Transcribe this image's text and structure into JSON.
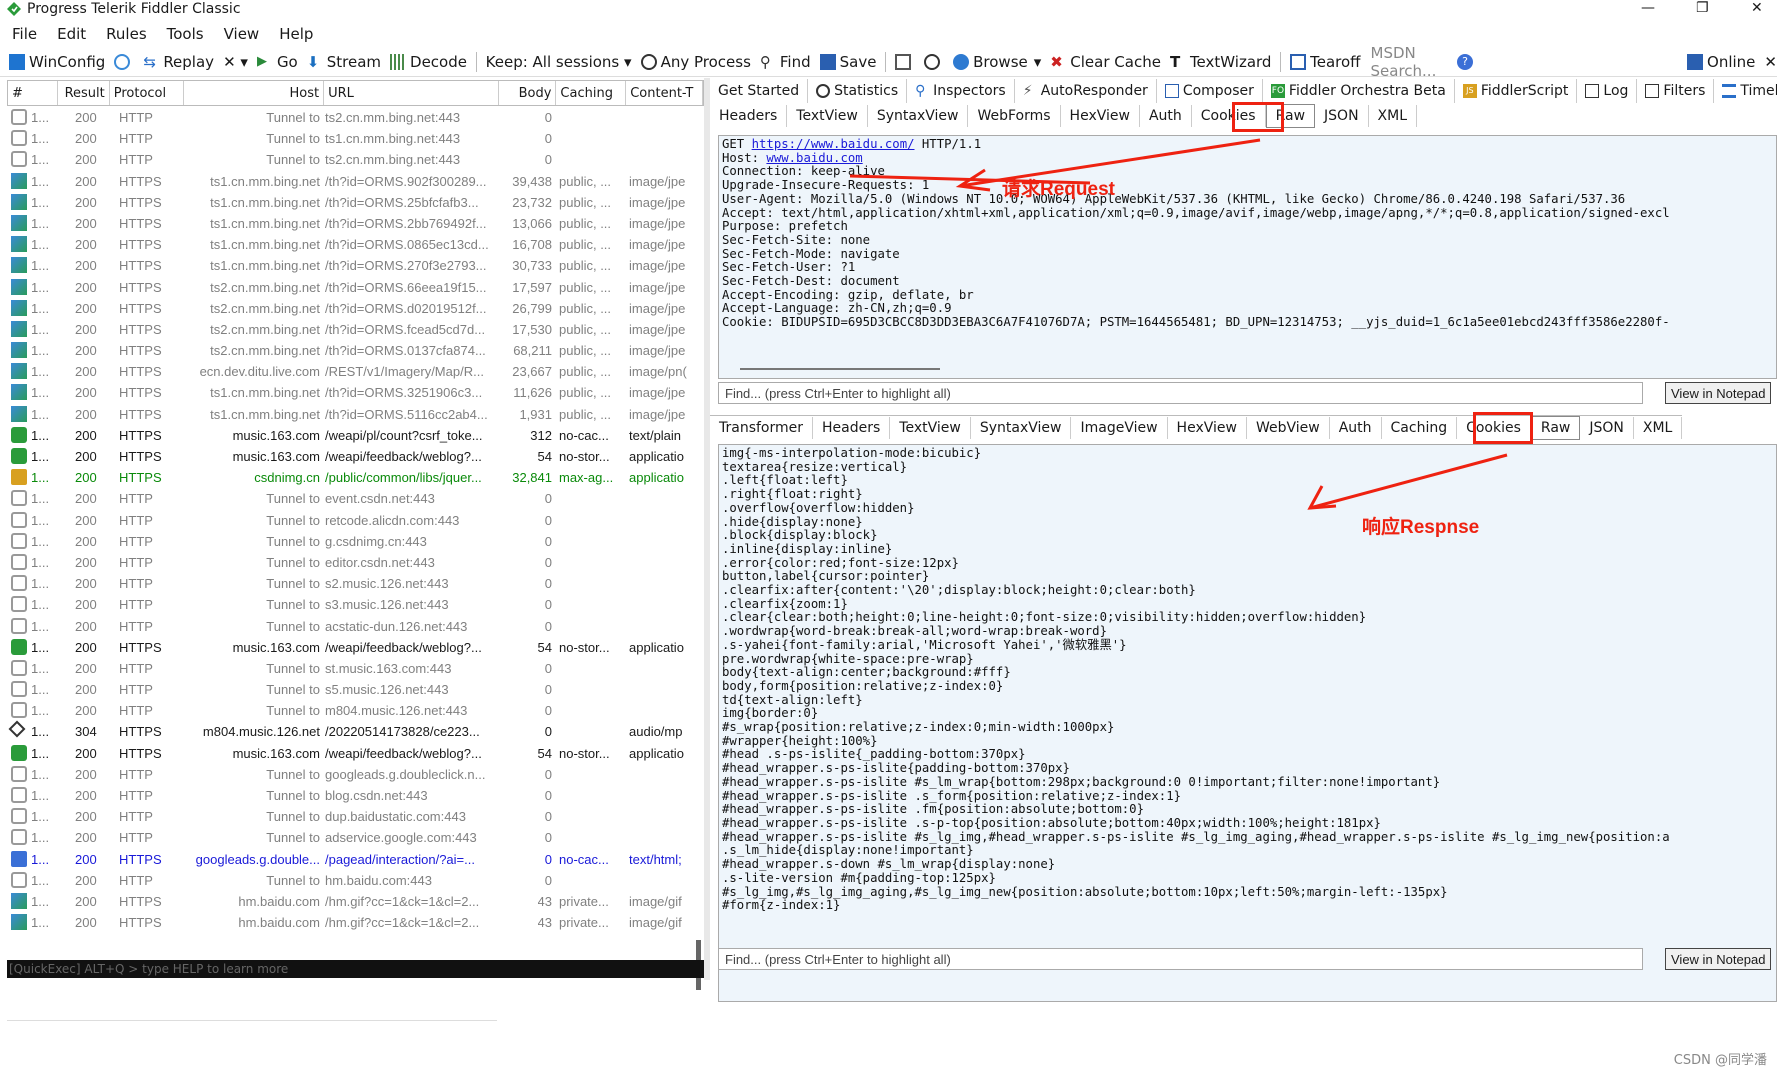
{
  "window": {
    "title": "Progress Telerik Fiddler Classic"
  },
  "window_controls": {
    "minimize": "—",
    "maximize": "❐",
    "close": "✕"
  },
  "menu": [
    "File",
    "Edit",
    "Rules",
    "Tools",
    "View",
    "Help"
  ],
  "toolbar": {
    "winconfig": "WinConfig",
    "replay": "Replay",
    "remove": "✕ ▾",
    "go": "Go",
    "stream": "Stream",
    "decode": "Decode",
    "keep": "Keep: All sessions ▾",
    "process": "Any Process",
    "find": "Find",
    "save": "Save",
    "browse": "Browse",
    "clear_cache": "Clear Cache",
    "textwizard": "TextWizard",
    "tearoff": "Tearoff",
    "msdn": "MSDN Search...",
    "online": "Online",
    "close": "✕"
  },
  "sessions": {
    "headers": [
      "#",
      "Result",
      "Protocol",
      "Host",
      "URL",
      "Body",
      "Caching",
      "Content-T"
    ],
    "rows": [
      {
        "n": "1...",
        "r": "200",
        "p": "HTTP",
        "h": "Tunnel to",
        "u": "ts2.cn.mm.bing.net:443",
        "b": "0",
        "c": "",
        "t": "",
        "s": "tunnel"
      },
      {
        "n": "1...",
        "r": "200",
        "p": "HTTP",
        "h": "Tunnel to",
        "u": "ts1.cn.mm.bing.net:443",
        "b": "0",
        "c": "",
        "t": "",
        "s": "tunnel"
      },
      {
        "n": "1...",
        "r": "200",
        "p": "HTTP",
        "h": "Tunnel to",
        "u": "ts2.cn.mm.bing.net:443",
        "b": "0",
        "c": "",
        "t": "",
        "s": "tunnel"
      },
      {
        "n": "1...",
        "r": "200",
        "p": "HTTPS",
        "h": "ts1.cn.mm.bing.net",
        "u": "/th?id=ORMS.902f300289...",
        "b": "39,438",
        "c": "public, ...",
        "t": "image/jpe",
        "s": "image"
      },
      {
        "n": "1...",
        "r": "200",
        "p": "HTTPS",
        "h": "ts1.cn.mm.bing.net",
        "u": "/th?id=ORMS.25bfcfafb3...",
        "b": "23,732",
        "c": "public, ...",
        "t": "image/jpe",
        "s": "image"
      },
      {
        "n": "1...",
        "r": "200",
        "p": "HTTPS",
        "h": "ts1.cn.mm.bing.net",
        "u": "/th?id=ORMS.2bb769492f...",
        "b": "13,066",
        "c": "public, ...",
        "t": "image/jpe",
        "s": "image"
      },
      {
        "n": "1...",
        "r": "200",
        "p": "HTTPS",
        "h": "ts1.cn.mm.bing.net",
        "u": "/th?id=ORMS.0865ec13cd...",
        "b": "16,708",
        "c": "public, ...",
        "t": "image/jpe",
        "s": "image"
      },
      {
        "n": "1...",
        "r": "200",
        "p": "HTTPS",
        "h": "ts1.cn.mm.bing.net",
        "u": "/th?id=ORMS.270f3e2793...",
        "b": "30,733",
        "c": "public, ...",
        "t": "image/jpe",
        "s": "image"
      },
      {
        "n": "1...",
        "r": "200",
        "p": "HTTPS",
        "h": "ts2.cn.mm.bing.net",
        "u": "/th?id=ORMS.66eea19f15...",
        "b": "17,597",
        "c": "public, ...",
        "t": "image/jpe",
        "s": "image"
      },
      {
        "n": "1...",
        "r": "200",
        "p": "HTTPS",
        "h": "ts2.cn.mm.bing.net",
        "u": "/th?id=ORMS.d02019512f...",
        "b": "26,799",
        "c": "public, ...",
        "t": "image/jpe",
        "s": "image"
      },
      {
        "n": "1...",
        "r": "200",
        "p": "HTTPS",
        "h": "ts2.cn.mm.bing.net",
        "u": "/th?id=ORMS.fcead5cd7d...",
        "b": "17,530",
        "c": "public, ...",
        "t": "image/jpe",
        "s": "image"
      },
      {
        "n": "1...",
        "r": "200",
        "p": "HTTPS",
        "h": "ts2.cn.mm.bing.net",
        "u": "/th?id=ORMS.0137cfa874...",
        "b": "68,211",
        "c": "public, ...",
        "t": "image/jpe",
        "s": "image"
      },
      {
        "n": "1...",
        "r": "200",
        "p": "HTTPS",
        "h": "ecn.dev.ditu.live.com",
        "u": "/REST/v1/Imagery/Map/R...",
        "b": "23,667",
        "c": "public, ...",
        "t": "image/pn(",
        "s": "image"
      },
      {
        "n": "1...",
        "r": "200",
        "p": "HTTPS",
        "h": "ts1.cn.mm.bing.net",
        "u": "/th?id=ORMS.3251906c3...",
        "b": "11,626",
        "c": "public, ...",
        "t": "image/jpe",
        "s": "image"
      },
      {
        "n": "1...",
        "r": "200",
        "p": "HTTPS",
        "h": "ts1.cn.mm.bing.net",
        "u": "/th?id=ORMS.5116cc2ab4...",
        "b": "1,931",
        "c": "public, ...",
        "t": "image/jpe",
        "s": "image"
      },
      {
        "n": "1...",
        "r": "200",
        "p": "HTTPS",
        "h": "music.163.com",
        "u": "/weapi/pl/count?csrf_toke...",
        "b": "312",
        "c": "no-cac...",
        "t": "text/plain",
        "s": "dark"
      },
      {
        "n": "1...",
        "r": "200",
        "p": "HTTPS",
        "h": "music.163.com",
        "u": "/weapi/feedback/weblog?...",
        "b": "54",
        "c": "no-stor...",
        "t": "applicatio",
        "s": "dark"
      },
      {
        "n": "1...",
        "r": "200",
        "p": "HTTPS",
        "h": "csdnimg.cn",
        "u": "/public/common/libs/jquer...",
        "b": "32,841",
        "c": "max-ag...",
        "t": "applicatio",
        "s": "green"
      },
      {
        "n": "1...",
        "r": "200",
        "p": "HTTP",
        "h": "Tunnel to",
        "u": "event.csdn.net:443",
        "b": "0",
        "c": "",
        "t": "",
        "s": "tunnel"
      },
      {
        "n": "1...",
        "r": "200",
        "p": "HTTP",
        "h": "Tunnel to",
        "u": "retcode.alicdn.com:443",
        "b": "0",
        "c": "",
        "t": "",
        "s": "tunnel"
      },
      {
        "n": "1...",
        "r": "200",
        "p": "HTTP",
        "h": "Tunnel to",
        "u": "g.csdnimg.cn:443",
        "b": "0",
        "c": "",
        "t": "",
        "s": "tunnel"
      },
      {
        "n": "1...",
        "r": "200",
        "p": "HTTP",
        "h": "Tunnel to",
        "u": "editor.csdn.net:443",
        "b": "0",
        "c": "",
        "t": "",
        "s": "tunnel"
      },
      {
        "n": "1...",
        "r": "200",
        "p": "HTTP",
        "h": "Tunnel to",
        "u": "s2.music.126.net:443",
        "b": "0",
        "c": "",
        "t": "",
        "s": "tunnel"
      },
      {
        "n": "1...",
        "r": "200",
        "p": "HTTP",
        "h": "Tunnel to",
        "u": "s3.music.126.net:443",
        "b": "0",
        "c": "",
        "t": "",
        "s": "tunnel"
      },
      {
        "n": "1...",
        "r": "200",
        "p": "HTTP",
        "h": "Tunnel to",
        "u": "acstatic-dun.126.net:443",
        "b": "0",
        "c": "",
        "t": "",
        "s": "tunnel"
      },
      {
        "n": "1...",
        "r": "200",
        "p": "HTTPS",
        "h": "music.163.com",
        "u": "/weapi/feedback/weblog?...",
        "b": "54",
        "c": "no-stor...",
        "t": "applicatio",
        "s": "dark"
      },
      {
        "n": "1...",
        "r": "200",
        "p": "HTTP",
        "h": "Tunnel to",
        "u": "st.music.163.com:443",
        "b": "0",
        "c": "",
        "t": "",
        "s": "tunnel"
      },
      {
        "n": "1...",
        "r": "200",
        "p": "HTTP",
        "h": "Tunnel to",
        "u": "s5.music.126.net:443",
        "b": "0",
        "c": "",
        "t": "",
        "s": "tunnel"
      },
      {
        "n": "1...",
        "r": "200",
        "p": "HTTP",
        "h": "Tunnel to",
        "u": "m804.music.126.net:443",
        "b": "0",
        "c": "",
        "t": "",
        "s": "tunnel"
      },
      {
        "n": "1...",
        "r": "304",
        "p": "HTTPS",
        "h": "m804.music.126.net",
        "u": "/20220514173828/ce223...",
        "b": "0",
        "c": "",
        "t": "audio/mp",
        "s": "media"
      },
      {
        "n": "1...",
        "r": "200",
        "p": "HTTPS",
        "h": "music.163.com",
        "u": "/weapi/feedback/weblog?...",
        "b": "54",
        "c": "no-stor...",
        "t": "applicatio",
        "s": "dark"
      },
      {
        "n": "1...",
        "r": "200",
        "p": "HTTP",
        "h": "Tunnel to",
        "u": "googleads.g.doubleclick.n...",
        "b": "0",
        "c": "",
        "t": "",
        "s": "tunnel"
      },
      {
        "n": "1...",
        "r": "200",
        "p": "HTTP",
        "h": "Tunnel to",
        "u": "blog.csdn.net:443",
        "b": "0",
        "c": "",
        "t": "",
        "s": "tunnel"
      },
      {
        "n": "1...",
        "r": "200",
        "p": "HTTP",
        "h": "Tunnel to",
        "u": "dup.baidustatic.com:443",
        "b": "0",
        "c": "",
        "t": "",
        "s": "tunnel"
      },
      {
        "n": "1...",
        "r": "200",
        "p": "HTTP",
        "h": "Tunnel to",
        "u": "adservice.google.com:443",
        "b": "0",
        "c": "",
        "t": "",
        "s": "tunnel"
      },
      {
        "n": "1...",
        "r": "200",
        "p": "HTTPS",
        "h": "googleads.g.double...",
        "u": "/pagead/interaction/?ai=...",
        "b": "0",
        "c": "no-cac...",
        "t": "text/html;",
        "s": "blue"
      },
      {
        "n": "1...",
        "r": "200",
        "p": "HTTP",
        "h": "Tunnel to",
        "u": "hm.baidu.com:443",
        "b": "0",
        "c": "",
        "t": "",
        "s": "tunnel"
      },
      {
        "n": "1...",
        "r": "200",
        "p": "HTTPS",
        "h": "hm.baidu.com",
        "u": "/hm.gif?cc=1&ck=1&cl=2...",
        "b": "43",
        "c": "private...",
        "t": "image/gif",
        "s": "image"
      },
      {
        "n": "1...",
        "r": "200",
        "p": "HTTPS",
        "h": "hm.baidu.com",
        "u": "/hm.gif?cc=1&ck=1&cl=2...",
        "b": "43",
        "c": "private...",
        "t": "image/gif",
        "s": "image"
      }
    ]
  },
  "quickexec": "[QuickExec] ALT+Q > type HELP to learn more",
  "main_tabs": [
    "Get Started",
    "Statistics",
    "Inspectors",
    "AutoResponder",
    "Composer",
    "Fiddler Orchestra Beta",
    "FiddlerScript",
    "Log",
    "Filters",
    "Timeline"
  ],
  "request_tabs": [
    "Headers",
    "TextView",
    "SyntaxView",
    "WebForms",
    "HexView",
    "Auth",
    "Cookies",
    "Raw",
    "JSON",
    "XML"
  ],
  "response_tabs": [
    "Transformer",
    "Headers",
    "TextView",
    "SyntaxView",
    "ImageView",
    "HexView",
    "WebView",
    "Auth",
    "Caching",
    "Cookies",
    "Raw",
    "JSON",
    "XML"
  ],
  "request": {
    "line_method": "GET ",
    "line_url": "https://www.baidu.com/",
    "line_ver": " HTTP/1.1",
    "host_label": "Host: ",
    "host_value": "www.baidu.com",
    "rest": "Connection: keep-alive\nUpgrade-Insecure-Requests: 1\nUser-Agent: Mozilla/5.0 (Windows NT 10.0; WOW64) AppleWebKit/537.36 (KHTML, like Gecko) Chrome/86.0.4240.198 Safari/537.36\nAccept: text/html,application/xhtml+xml,application/xml;q=0.9,image/avif,image/webp,image/apng,*/*;q=0.8,application/signed-excl\nPurpose: prefetch\nSec-Fetch-Site: none\nSec-Fetch-Mode: navigate\nSec-Fetch-User: ?1\nSec-Fetch-Dest: document\nAccept-Encoding: gzip, deflate, br\nAccept-Language: zh-CN,zh;q=0.9\nCookie: BIDUPSID=695D3CBCC8D3DD3EBA3C6A7F41076D7A; PSTM=1644565481; BD_UPN=12314753; __yjs_duid=1_6c1a5ee01ebcd243fff3586e2280f-"
  },
  "response": {
    "body": "img{-ms-interpolation-mode:bicubic}\ntextarea{resize:vertical}\n.left{float:left}\n.right{float:right}\n.overflow{overflow:hidden}\n.hide{display:none}\n.block{display:block}\n.inline{display:inline}\n.error{color:red;font-size:12px}\nbutton,label{cursor:pointer}\n.clearfix:after{content:'\\20';display:block;height:0;clear:both}\n.clearfix{zoom:1}\n.clear{clear:both;height:0;line-height:0;font-size:0;visibility:hidden;overflow:hidden}\n.wordwrap{word-break:break-all;word-wrap:break-word}\n.s-yahei{font-family:arial,'Microsoft Yahei','微软雅黑'}\npre.wordwrap{white-space:pre-wrap}\nbody{text-align:center;background:#fff}\nbody,form{position:relative;z-index:0}\ntd{text-align:left}\nimg{border:0}\n#s_wrap{position:relative;z-index:0;min-width:1000px}\n#wrapper{height:100%}\n#head .s-ps-islite{_padding-bottom:370px}\n#head_wrapper.s-ps-islite{padding-bottom:370px}\n#head_wrapper.s-ps-islite #s_lm_wrap{bottom:298px;background:0 0!important;filter:none!important}\n#head_wrapper.s-ps-islite .s_form{position:relative;z-index:1}\n#head_wrapper.s-ps-islite .fm{position:absolute;bottom:0}\n#head_wrapper.s-ps-islite .s-p-top{position:absolute;bottom:40px;width:100%;height:181px}\n#head_wrapper.s-ps-islite #s_lg_img,#head_wrapper.s-ps-islite #s_lg_img_aging,#head_wrapper.s-ps-islite #s_lg_img_new{position:a\n.s_lm_hide{display:none!important}\n#head_wrapper.s-down #s_lm_wrap{display:none}\n.s-lite-version #m{padding-top:125px}\n#s_lg_img,#s_lg_img_aging,#s_lg_img_new{position:absolute;bottom:10px;left:50%;margin-left:-135px}\n#form{z-index:1}"
  },
  "find_placeholder": "Find... (press Ctrl+Enter to highlight all)",
  "view_notepad": "View in Notepad",
  "annotations": {
    "request": "请求Request",
    "response": "响应Respnse"
  },
  "credit": "CSDN @同学潘",
  "colors": {
    "accent_red": "#e21",
    "pane_bg": "#eef5fb",
    "link_blue": "#1a1ad8"
  }
}
